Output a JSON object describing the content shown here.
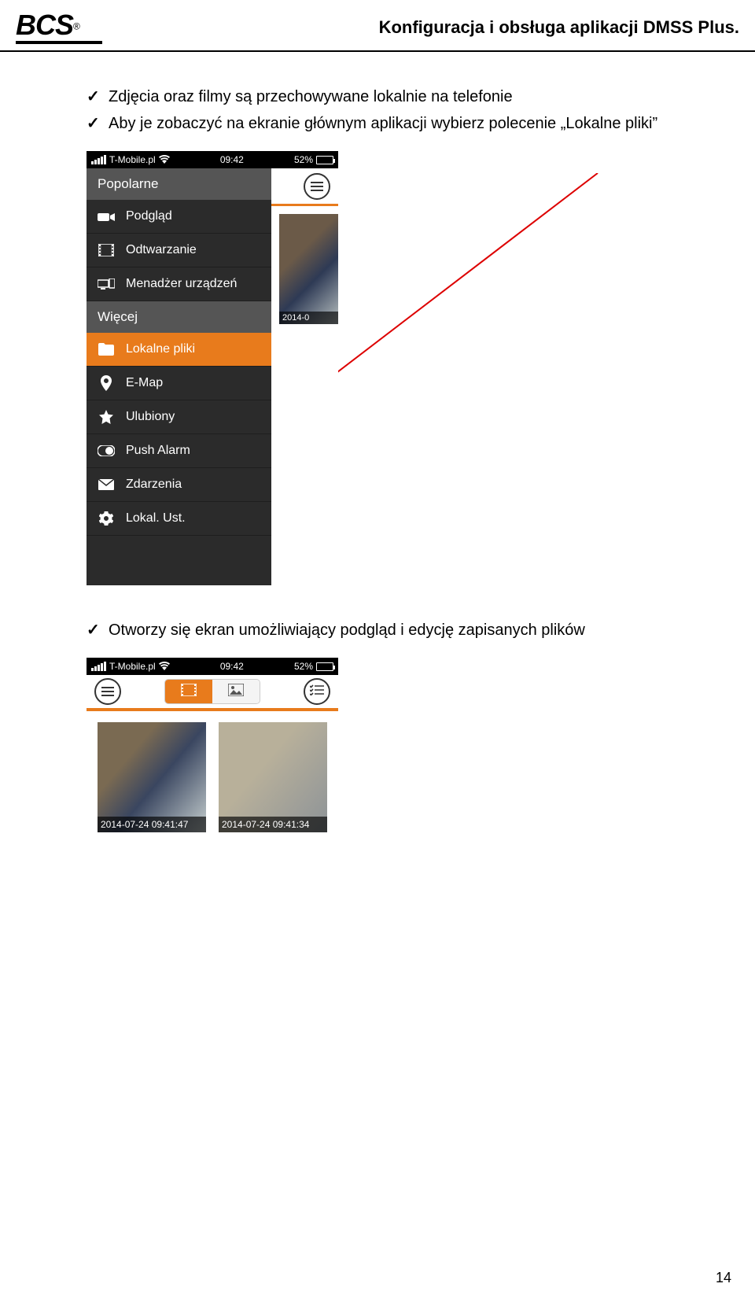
{
  "header": {
    "logo_text": "BCS",
    "logo_reg": "®",
    "doc_title": "Konfiguracja i obsługa aplikacji DMSS Plus."
  },
  "bullets_top": [
    "Zdjęcia oraz filmy są przechowywane lokalnie na telefonie",
    "Aby je zobaczyć na ekranie głównym aplikacji wybierz polecenie „Lokalne pliki”"
  ],
  "bullets_bottom": [
    "Otworzy się ekran umożliwiający podgląd i edycję zapisanych plików"
  ],
  "phone": {
    "status": {
      "carrier": "T-Mobile.pl",
      "time": "09:42",
      "battery_pct": "52%"
    },
    "menu": {
      "section_popular": "Popolarne",
      "section_more": "Więcej",
      "items": [
        {
          "label": "Podgląd",
          "icon": "camera-icon"
        },
        {
          "label": "Odtwarzanie",
          "icon": "film-icon"
        },
        {
          "label": "Menadżer urządzeń",
          "icon": "devices-icon"
        },
        {
          "label": "Lokalne pliki",
          "icon": "folder-icon",
          "active": true
        },
        {
          "label": "E-Map",
          "icon": "map-pin-icon"
        },
        {
          "label": "Ulubiony",
          "icon": "star-icon"
        },
        {
          "label": "Push Alarm",
          "icon": "push-icon"
        },
        {
          "label": "Zdarzenia",
          "icon": "mail-icon"
        },
        {
          "label": "Lokal. Ust.",
          "icon": "gear-icon"
        }
      ],
      "behind_ts": "2014-0"
    },
    "gallery": {
      "thumbs": [
        {
          "ts": "2014-07-24 09:41:47"
        },
        {
          "ts": "2014-07-24 09:41:34"
        }
      ]
    }
  },
  "page_number": "14"
}
